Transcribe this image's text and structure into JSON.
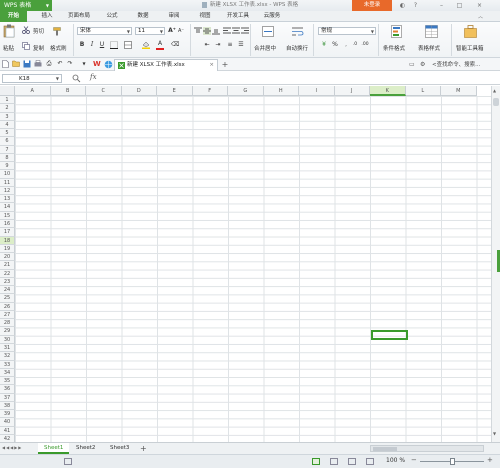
{
  "titlebar": {
    "app_name": "WPS 表格",
    "doc_title": "新建 XLSX 工作表.xlsx - WPS 表格",
    "login_label": "未登录"
  },
  "ribbon_tabs": [
    "开始",
    "插入",
    "页面布局",
    "公式",
    "数据",
    "审阅",
    "视图",
    "开发工具",
    "云服务"
  ],
  "ribbon": {
    "paste": "粘贴",
    "cut": "剪切",
    "copy": "复制",
    "format_painter": "格式刷",
    "font_name": "宋体",
    "font_size": "11",
    "merge_center": "合并居中",
    "wrap_text": "自动换行",
    "number_format": "常规",
    "conditional_format": "条件格式",
    "table_style": "表格样式",
    "smart_toolbox": "智能工具箱"
  },
  "qat": {
    "doc_tab": "新建 XLSX 工作表.xlsx",
    "search_placeholder": "<查找命令、搜索...",
    "accent_color": "#4aa03c",
    "wps_logo_color": "#d9322a"
  },
  "formula_bar": {
    "name_box": "K18",
    "fx_label": "fx",
    "content": ""
  },
  "grid": {
    "columns": [
      "A",
      "B",
      "C",
      "D",
      "E",
      "F",
      "G",
      "H",
      "I",
      "J",
      "K",
      "L",
      "M"
    ],
    "rows": [
      "1",
      "2",
      "3",
      "4",
      "5",
      "6",
      "7",
      "8",
      "9",
      "10",
      "11",
      "12",
      "13",
      "14",
      "15",
      "16",
      "17",
      "18",
      "19",
      "20",
      "21",
      "22",
      "23",
      "24",
      "25",
      "26",
      "27",
      "28",
      "29",
      "30",
      "31",
      "32",
      "33",
      "34",
      "35",
      "36",
      "37",
      "38",
      "39",
      "40",
      "41",
      "42"
    ],
    "active_column": "K",
    "active_row": "18"
  },
  "sheets": [
    "Sheet1",
    "Sheet2",
    "Sheet3"
  ],
  "status": {
    "zoom": "100 %"
  }
}
